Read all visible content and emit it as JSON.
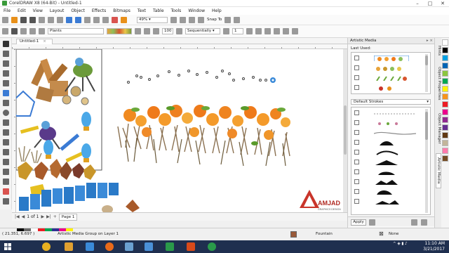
{
  "window": {
    "title": "CorelDRAW X8 (64-Bit) - Untitled-1"
  },
  "menu": [
    "File",
    "Edit",
    "View",
    "Layout",
    "Object",
    "Effects",
    "Bitmaps",
    "Text",
    "Table",
    "Tools",
    "Window",
    "Help"
  ],
  "toolbar": {
    "zoom": "49%",
    "snap_to": "Snap To"
  },
  "propertybar": {
    "preset": "Plants",
    "size": "100",
    "spacing": "1",
    "sequential": "Sequentially"
  },
  "document": {
    "tab": "Untitled-1",
    "page_label": "Page 1",
    "page_counter": "1 of 1"
  },
  "docker": {
    "title": "Artistic Media",
    "last_used_label": "Last Used:",
    "strokes_dropdown": "Default Strokes",
    "apply": "Apply"
  },
  "sidetabs": [
    "Hints",
    "Object Properties",
    "Object Manager",
    "Artistic Media"
  ],
  "status": {
    "coords": "( 21.351, 6.697 )",
    "info": "Artistic Media Group on Layer 1",
    "fill": "Fountain",
    "outline": "None"
  },
  "logo": {
    "text": "AMJAD",
    "sub": "GRAPHICS DESIGN"
  },
  "taskbar": {
    "time": "11:10 AM",
    "date": "3/21/2017"
  },
  "colors": {
    "palette": [
      "#ffffff",
      "#000000",
      "#00a0e3",
      "#0064b4",
      "#8cc63f",
      "#00a651",
      "#fff200",
      "#f7941d",
      "#ed1c24",
      "#ec008c",
      "#92278f",
      "#662d91",
      "#603913",
      "#c2b59b",
      "#ff7bac",
      "#754c24"
    ],
    "doc_palette": [
      "#000000",
      "#6a6a6a",
      "#ffffff",
      "#ed1c24",
      "#00a651",
      "#2e3192",
      "#ec008c",
      "#fff200"
    ]
  }
}
